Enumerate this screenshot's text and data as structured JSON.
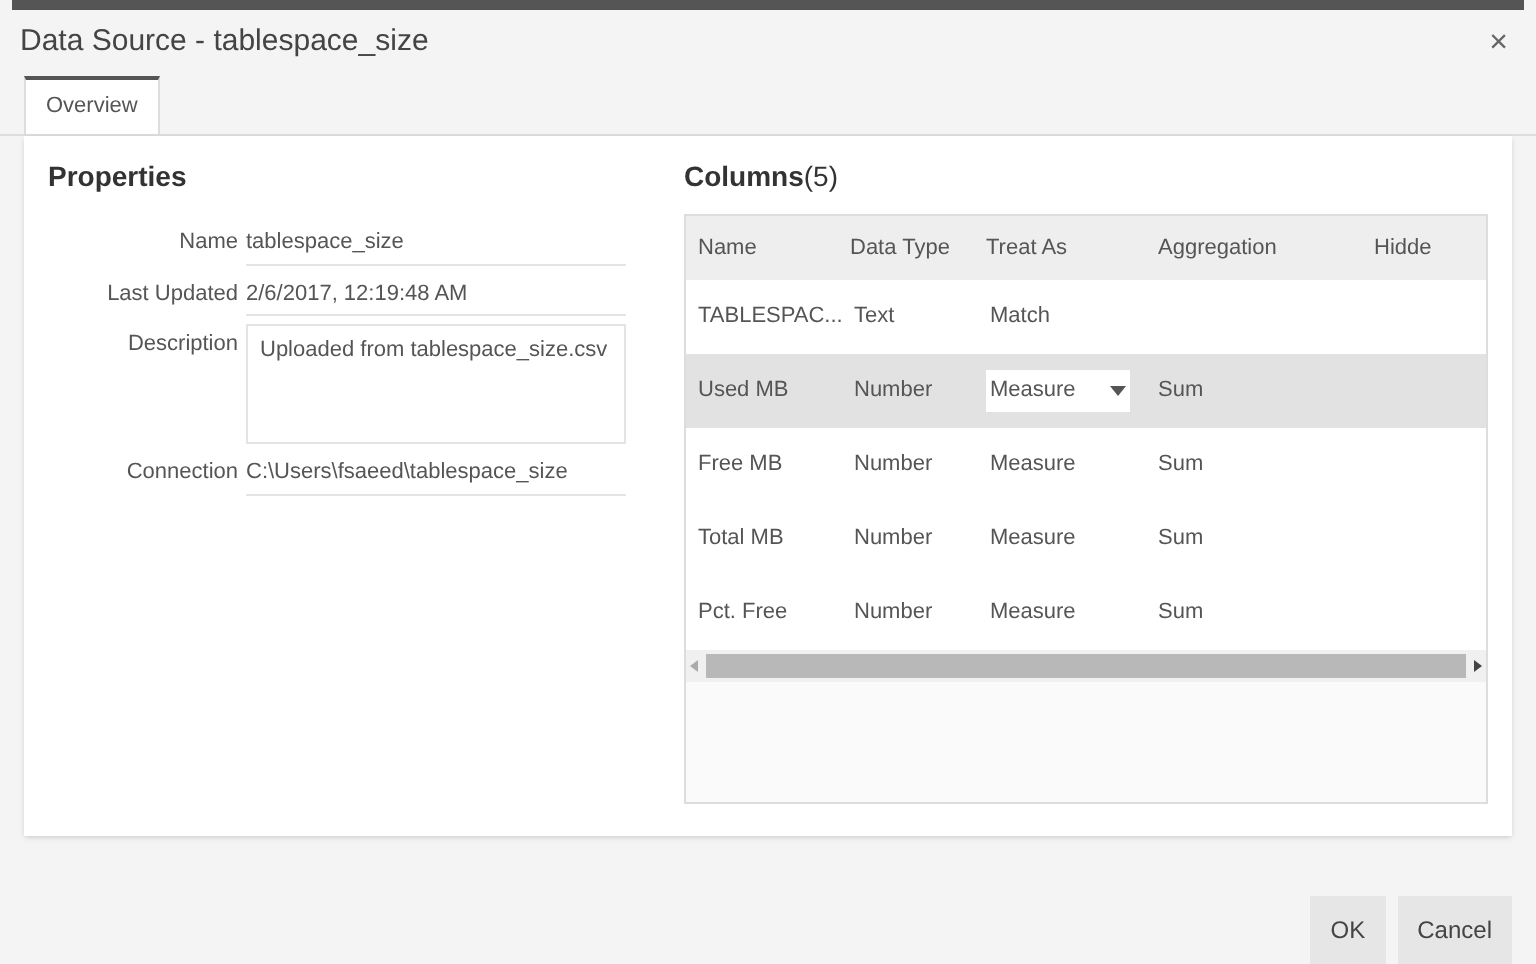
{
  "window": {
    "title": "Data Source - tablespace_size",
    "close": "×"
  },
  "tabs": [
    {
      "label": "Overview",
      "selected": true
    }
  ],
  "properties": {
    "title": "Properties",
    "fields": [
      {
        "label": "Name",
        "value": "tablespace_size",
        "kind": "text"
      },
      {
        "label": "Last Updated",
        "value": "2/6/2017, 12:19:48 AM",
        "kind": "text"
      },
      {
        "label": "Description",
        "value": "Uploaded from tablespace_size.csv",
        "kind": "area"
      },
      {
        "label": "Connection",
        "value": "C:\\Users\\fsaeed\\tablespace_size",
        "kind": "text"
      }
    ]
  },
  "columns_panel": {
    "title": "Columns",
    "count": "(5)",
    "table": {
      "columns": [
        "Name",
        "Data Type",
        "Treat As",
        "Aggregation",
        "Hidde"
      ],
      "rows": [
        {
          "selected": false,
          "cells": [
            "TABLESPAC...",
            "Text",
            "Match",
            ""
          ],
          "kind": "text"
        },
        {
          "selected": true,
          "cells": [
            "Used MB",
            "Number",
            "Measure",
            "Sum"
          ],
          "kind": "dropdown"
        },
        {
          "selected": false,
          "cells": [
            "Free MB",
            "Number",
            "Measure",
            "Sum"
          ],
          "kind": "text"
        },
        {
          "selected": false,
          "cells": [
            "Total MB",
            "Number",
            "Measure",
            "Sum"
          ],
          "kind": "text"
        },
        {
          "selected": false,
          "cells": [
            "Pct. Free",
            "Number",
            "Measure",
            "Sum"
          ],
          "kind": "text"
        }
      ]
    }
  },
  "buttons": [
    "OK",
    "Cancel"
  ]
}
